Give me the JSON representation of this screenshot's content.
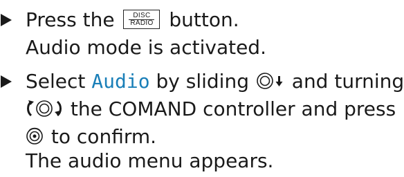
{
  "steps": [
    {
      "lines": [
        {
          "pre": "Press the",
          "post": "button."
        },
        {
          "text": "Audio mode is activated."
        }
      ],
      "button": {
        "top": "DISC",
        "bottom": "RADIO"
      }
    },
    {
      "lines": [
        {
          "pre": "Select",
          "highlight": "Audio",
          "mid": "by sliding",
          "post": "and turning"
        },
        {
          "post": "the COMAND controller and press"
        },
        {
          "post": "to confirm."
        },
        {
          "text": "The audio menu appears."
        }
      ]
    }
  ],
  "icons": {
    "bullet": "triangle-bullet-icon",
    "slide_down": "controller-slide-down-icon",
    "turn": "controller-turn-icon",
    "press": "controller-press-icon"
  },
  "colors": {
    "text": "#1a1a1a",
    "highlight": "#1a7fb8"
  }
}
